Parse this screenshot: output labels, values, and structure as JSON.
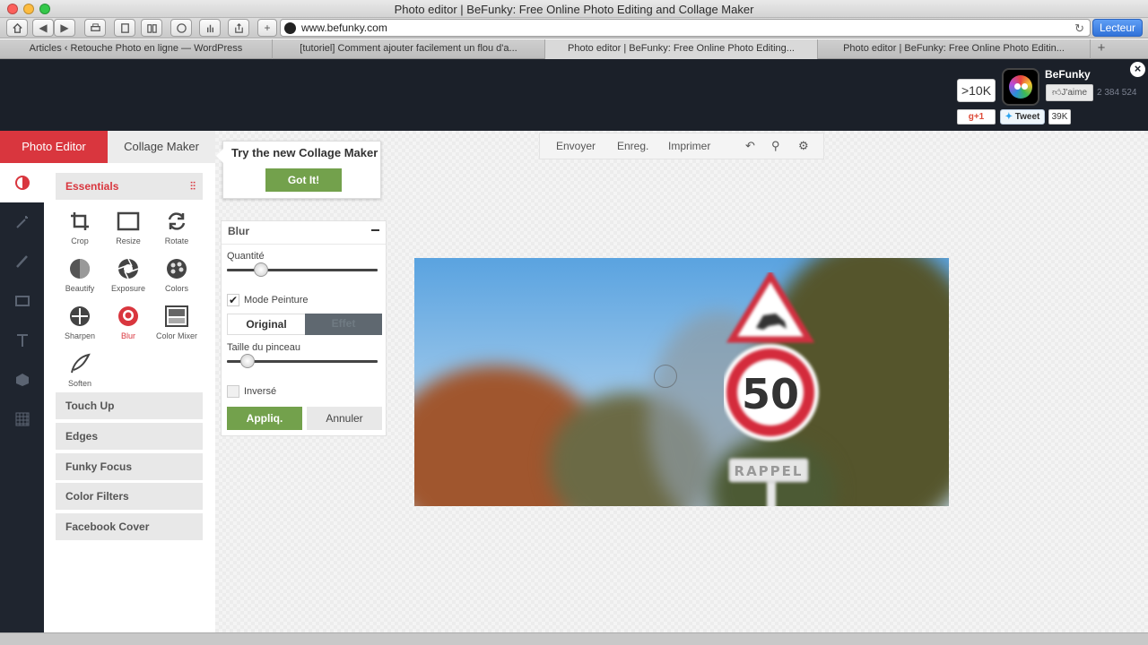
{
  "browser": {
    "window_title": "Photo editor | BeFunky: Free Online Photo Editing and Collage Maker",
    "url": "www.befunky.com",
    "reader_label": "Lecteur",
    "tabs": [
      "Articles ‹ Retouche Photo en ligne — WordPress",
      "[tutoriel] Comment ajouter facilement un flou d'a...",
      "Photo editor | BeFunky: Free Online Photo Editing...",
      "Photo editor | BeFunky: Free Online Photo Editin..."
    ],
    "active_tab_index": 2
  },
  "header": {
    "fb_count": ">10K",
    "brand_name": "BeFunky",
    "like_label": "J'aime",
    "like_count": "2 384 524",
    "gplus_label": "+1",
    "tweet_label": "Tweet",
    "tweet_count": "39K"
  },
  "mode_tabs": {
    "photo_editor": "Photo Editor",
    "collage_maker": "Collage Maker"
  },
  "tooltip": {
    "text": "Try the new Collage Maker",
    "button": "Got It!"
  },
  "actions": {
    "send": "Envoyer",
    "save": "Enreg.",
    "print": "Imprimer"
  },
  "tools_panel": {
    "essentials_label": "Essentials",
    "tools": [
      {
        "label": "Crop",
        "icon": "crop-icon"
      },
      {
        "label": "Resize",
        "icon": "resize-icon"
      },
      {
        "label": "Rotate",
        "icon": "rotate-icon"
      },
      {
        "label": "Beautify",
        "icon": "beautify-icon"
      },
      {
        "label": "Exposure",
        "icon": "exposure-icon"
      },
      {
        "label": "Colors",
        "icon": "colors-icon"
      },
      {
        "label": "Sharpen",
        "icon": "sharpen-icon"
      },
      {
        "label": "Blur",
        "icon": "blur-icon"
      },
      {
        "label": "Color Mixer",
        "icon": "color-mixer-icon"
      },
      {
        "label": "Soften",
        "icon": "soften-icon"
      }
    ],
    "active_tool": "Blur",
    "sections": [
      "Touch Up",
      "Edges",
      "Funky Focus",
      "Color Filters",
      "Facebook Cover"
    ]
  },
  "blur_panel": {
    "title": "Blur",
    "quantity_label": "Quantité",
    "quantity_level": 0.2,
    "paint_mode_label": "Mode Peinture",
    "paint_mode_checked": true,
    "segment_original": "Original",
    "segment_effect": "Effet",
    "brush_size_label": "Taille du pinceau",
    "brush_size_level": 0.1,
    "inverse_label": "Inversé",
    "inverse_checked": false,
    "apply_label": "Appliq.",
    "cancel_label": "Annuler"
  },
  "photo": {
    "sign_number": "50",
    "sign_text": "RAPPEL"
  },
  "colors": {
    "accent_red": "#d9363e",
    "green": "#73a14c",
    "header_dark": "#1b2029"
  }
}
